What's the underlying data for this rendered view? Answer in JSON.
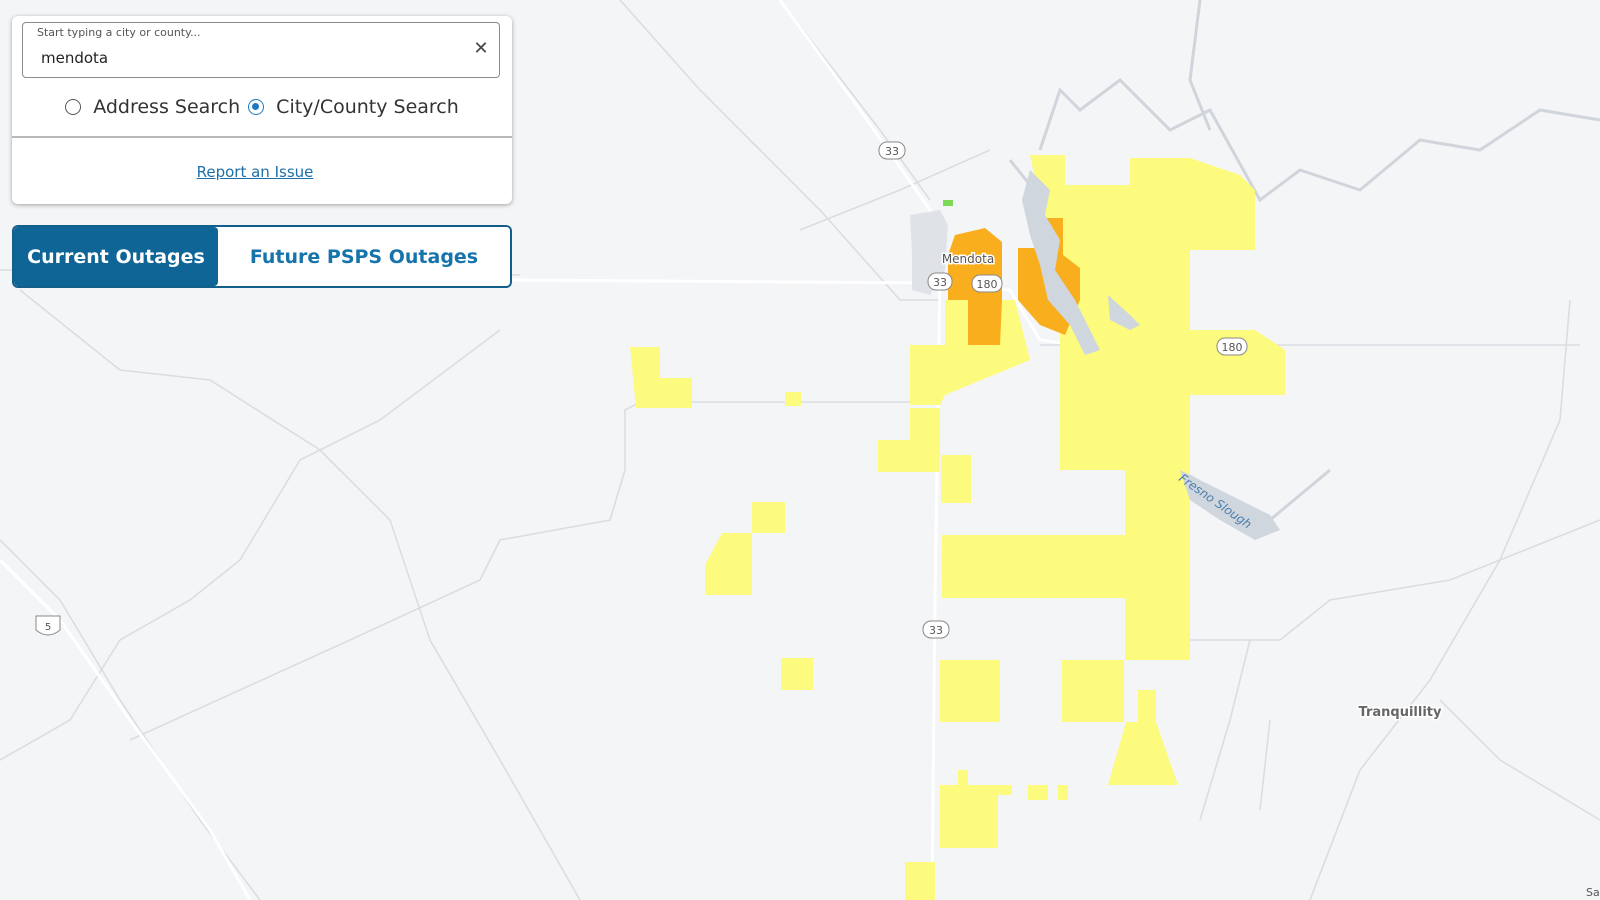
{
  "search": {
    "label": "Start typing a city or county...",
    "value": "mendota",
    "clear_symbol": "✕",
    "modes": [
      {
        "label": "Address Search",
        "selected": false
      },
      {
        "label": "City/County Search",
        "selected": true
      }
    ],
    "report_link": "Report an Issue"
  },
  "toggle": {
    "current": "Current Outages",
    "future": "Future PSPS Outages",
    "active": "current"
  },
  "map": {
    "places": {
      "mendota": "Mendota",
      "tranquillity": "Tranquillity",
      "fresno_slough": "Fresno Slough",
      "corner": "Sa"
    },
    "shields": {
      "hwy33_north": "33",
      "hwy33_city": "33",
      "hwy33_south": "33",
      "hwy180_city": "180",
      "hwy180_east": "180",
      "i5": "5"
    },
    "colors": {
      "background": "#f4f5f7",
      "outage_minor": "#fdfb7d",
      "outage_major": "#f9ae1d",
      "water": "#cfd6de",
      "accent": "#0f6596"
    }
  }
}
